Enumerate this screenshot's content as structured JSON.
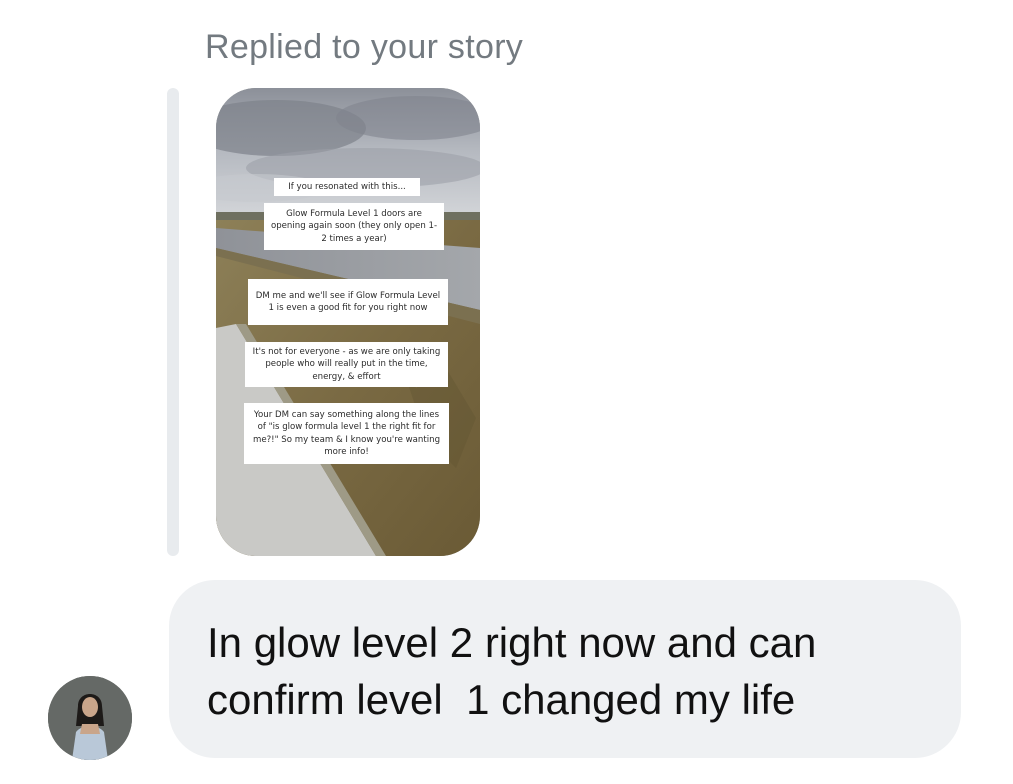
{
  "reply_label": "Replied to your story",
  "story": {
    "texts": [
      "If you resonated with this...",
      "Glow Formula Level 1 doors are opening again soon (they only open 1-2 times a year)",
      "DM me and we'll see if Glow Formula Level 1 is even a good fit for you right now",
      "It's not for everyone - as we are only taking people who will really put in the time, energy, & effort",
      "Your DM can say something along the lines of \"is glow formula level 1 the right fit for me?!\" So my team & I know you're wanting more info!"
    ]
  },
  "message": {
    "text": "In glow level 2 right now and can\nconfirm level  1 changed my life"
  },
  "colors": {
    "bubble": "#eff1f3",
    "label": "#737a80",
    "reply_bar": "#e8ebee"
  }
}
